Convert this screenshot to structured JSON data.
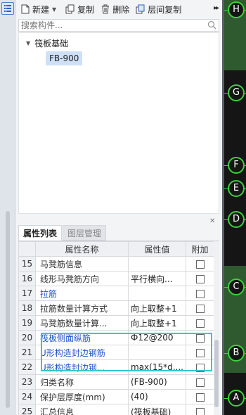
{
  "toolbar": {
    "new_label": "新建",
    "copy_label": "复制",
    "delete_label": "删除",
    "floor_copy_label": "层间复制"
  },
  "search": {
    "placeholder": "搜索构件..."
  },
  "tree": {
    "group_label": "筏板基础",
    "items": [
      {
        "label": "FB-900",
        "selected": true
      }
    ]
  },
  "tabs": [
    {
      "label": "属性列表",
      "active": true
    },
    {
      "label": "图层管理",
      "active": false
    }
  ],
  "table": {
    "headers": [
      "",
      "属性名称",
      "属性值",
      "附加"
    ],
    "rows": [
      {
        "num": "15",
        "name": "马凳筋信息",
        "value": "",
        "blue": false,
        "checkbox": true
      },
      {
        "num": "16",
        "name": "线形马凳筋方向",
        "value": "平行横向...",
        "blue": false,
        "checkbox": true
      },
      {
        "num": "17",
        "name": "拉筋",
        "value": "",
        "blue": true,
        "checkbox": true
      },
      {
        "num": "18",
        "name": "拉筋数量计算方式",
        "value": "向上取整+1",
        "blue": false,
        "checkbox": true
      },
      {
        "num": "19",
        "name": "马凳筋数量计算...",
        "value": "向上取整+1",
        "blue": false,
        "checkbox": true
      },
      {
        "num": "20",
        "name": "筏板侧面纵筋",
        "value": "Ф12@200",
        "blue": true,
        "checkbox": true
      },
      {
        "num": "21",
        "name": "U形构造封边钢筋",
        "value": "",
        "blue": true,
        "checkbox": true
      },
      {
        "num": "22",
        "name": "U形构造封边钢...",
        "value": "max(15*d,...",
        "blue": true,
        "checkbox": true
      },
      {
        "num": "23",
        "name": "归类名称",
        "value": "(FB-900)",
        "blue": false,
        "checkbox": true
      },
      {
        "num": "24",
        "name": "保护层厚度(mm)",
        "value": "(40)",
        "blue": false,
        "checkbox": true
      },
      {
        "num": "25",
        "name": "汇总信息",
        "value": "(筏板基础)",
        "blue": false,
        "checkbox": true
      }
    ]
  },
  "axes": [
    "H",
    "G",
    "F",
    "E",
    "D",
    "C",
    "B",
    "A"
  ],
  "colors": {
    "highlight": "#35c8c8",
    "axis_green": "#3bd13b",
    "link_blue": "#2050c8",
    "selected_bg": "#cfe0f6"
  }
}
